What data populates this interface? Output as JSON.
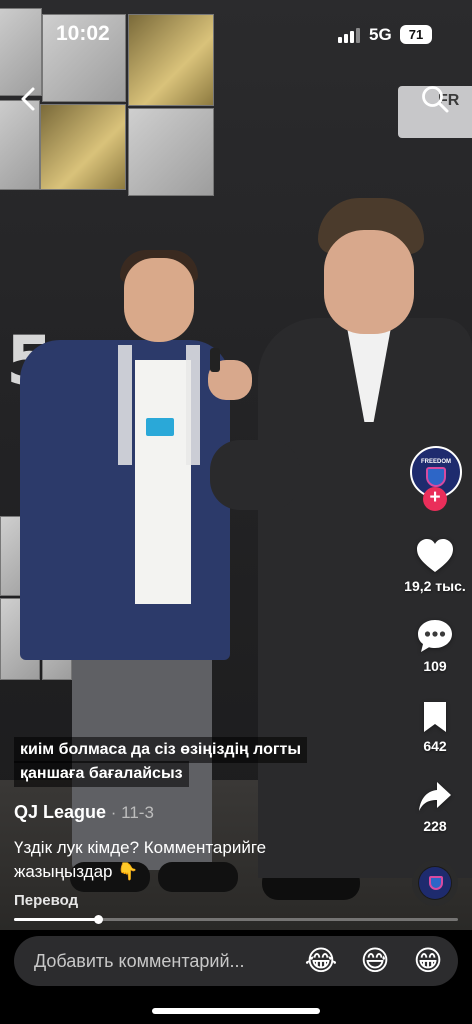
{
  "status": {
    "time": "10:02",
    "network": "5G",
    "battery": "71"
  },
  "scene": {
    "sponsor_text": "FR"
  },
  "rail": {
    "likes": "19,2 тыс.",
    "comments": "109",
    "saves": "642",
    "shares": "228",
    "follow_symbol": "+",
    "avatar_logo_text": "FREEDOM"
  },
  "caption": {
    "banner_line1": "киім болмаса да сіз өзіңіздің логты",
    "banner_line2": "қаншаға бағалайсыз",
    "author": "QJ League",
    "date": " · 11-3",
    "description": "Үздік лук кімде? Комментарийге жазыңыздар 👇",
    "translate": "Перевод",
    "progress_fraction": 0.19
  },
  "comment_bar": {
    "placeholder": "Добавить комментарий...",
    "emojis": [
      "😂",
      "😅",
      "😁"
    ]
  },
  "icons": [
    "back-icon",
    "search-icon",
    "heart-icon",
    "comment-icon",
    "bookmark-icon",
    "share-icon",
    "music-disc-icon"
  ]
}
